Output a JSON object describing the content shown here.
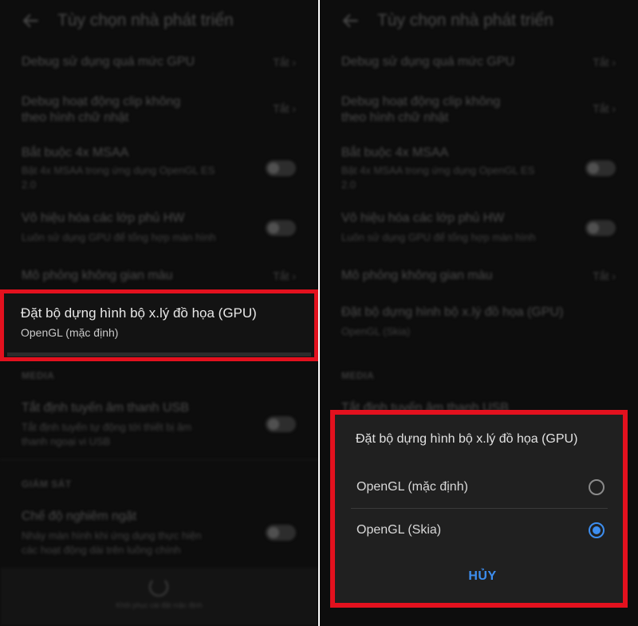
{
  "header": {
    "title": "Tùy chọn nhà phát triển"
  },
  "settings": {
    "gpu_overdraw": {
      "title": "Debug sử dụng quá mức GPU",
      "value": "Tắt"
    },
    "clip_ops": {
      "title_line1": "Debug hoạt động clip không",
      "title_line2": "theo hình chữ nhật",
      "value": "Tắt"
    },
    "msaa": {
      "title": "Bắt buộc 4x MSAA",
      "sub_line1": "Bật 4x MSAA trong ứng dụng OpenGL ES",
      "sub_line2": "2.0"
    },
    "hw_overlays": {
      "title": "Vô hiệu hóa các lớp phủ HW",
      "sub": "Luôn sử dụng GPU để tổng hợp màn hình"
    },
    "color_space": {
      "title": "Mô phỏng không gian màu",
      "value": "Tắt"
    },
    "renderer": {
      "title": "Đặt bộ dựng hình bộ x.lý đồ họa (GPU)",
      "value_left": "OpenGL (mặc định)",
      "value_right": "OpenGL (Skia)"
    }
  },
  "sections": {
    "media": "MEDIA",
    "monitoring": "GIÁM SÁT"
  },
  "media": {
    "usb_audio": {
      "title": "Tắt định tuyến âm thanh USB",
      "sub_line1": "Tắt định tuyến tự động tới thiết bị âm",
      "sub_line2": "thanh ngoại vi USB"
    }
  },
  "monitoring": {
    "strict_mode": {
      "title": "Chế độ nghiêm ngặt",
      "sub_line1": "Nháy màn hình khi ứng dụng thực hiện",
      "sub_line2": "các hoạt động dài trên luồng chính"
    }
  },
  "bottom_bar": {
    "caption": "Khôi phục cài đặt mặc định"
  },
  "dialog": {
    "title": "Đặt bộ dựng hình bộ x.lý đồ họa (GPU)",
    "options": [
      {
        "label": "OpenGL (mặc định)",
        "selected": false
      },
      {
        "label": "OpenGL (Skia)",
        "selected": true
      }
    ],
    "cancel_label": "HỦY"
  },
  "colors": {
    "highlight": "#e3111e",
    "accent": "#3d8ef0"
  },
  "icons": {
    "back": "arrow-left-icon",
    "reset": "refresh-icon"
  }
}
